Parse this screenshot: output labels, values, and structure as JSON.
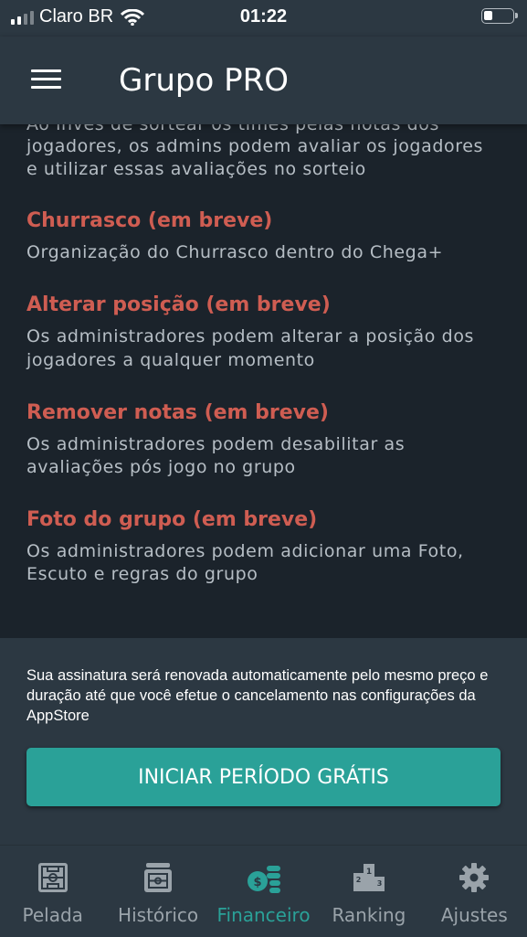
{
  "status_bar": {
    "carrier": "Claro BR",
    "time": "01:22"
  },
  "header": {
    "title": "Grupo PRO",
    "menu_icon": "hamburger-menu-icon"
  },
  "features": [
    {
      "title": "",
      "description_lines": [
        "Ao invés de sortear os times pelas notas dos",
        "jogadores, os admins podem avaliar os jogadores",
        "e utilizar essas avaliações no sorteio"
      ]
    },
    {
      "title": "Churrasco (em breve)",
      "description_lines": [
        "Organização do Churrasco dentro do Chega+"
      ]
    },
    {
      "title": "Alterar posição (em breve)",
      "description_lines": [
        "Os administradores podem alterar a posição dos",
        "jogadores a qualquer momento"
      ]
    },
    {
      "title": "Remover notas (em breve)",
      "description_lines": [
        "Os administradores podem desabilitar as",
        "avaliações pós jogo no grupo"
      ]
    },
    {
      "title": "Foto do grupo (em breve)",
      "description_lines": [
        "Os administradores podem adicionar uma Foto,",
        "Escuto e regras do grupo"
      ]
    }
  ],
  "footer": {
    "renewal_note": "Sua assinatura será renovada automaticamente pelo mesmo preço e duração até que você efetue o cancelamento nas configurações da AppStore",
    "cta_label": "INICIAR PERÍODO GRÁTIS"
  },
  "tabs": [
    {
      "label": "Pelada",
      "icon": "soccer-field-icon"
    },
    {
      "label": "Histórico",
      "icon": "history-icon"
    },
    {
      "label": "Financeiro",
      "icon": "coins-money-icon",
      "active": true
    },
    {
      "label": "Ranking",
      "icon": "podium-ranking-icon"
    },
    {
      "label": "Ajustes",
      "icon": "gear-icon"
    }
  ],
  "colors": {
    "accent": "#2aa198",
    "feature_title": "#cf5d52",
    "background": "#1b232b",
    "panel": "#2c3842"
  }
}
